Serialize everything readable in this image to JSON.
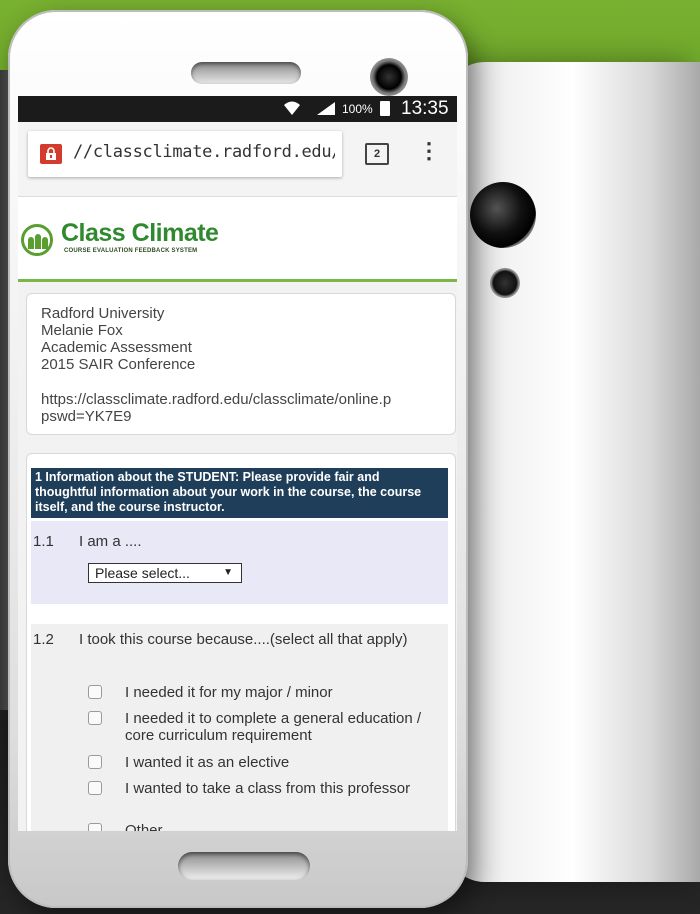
{
  "status": {
    "battery": "100%",
    "time": "13:35"
  },
  "browser": {
    "url": "//classclimate.radford.edu/c",
    "tab_count": "2",
    "menu_icon": "⋮"
  },
  "logo": {
    "title": "Class Climate",
    "subtitle": "COURSE EVALUATION FEEDBACK SYSTEM"
  },
  "info": {
    "lines": [
      "Radford University",
      "Melanie Fox",
      "Academic Assessment",
      "2015 SAIR Conference"
    ],
    "link_line1": "https://classclimate.radford.edu/classclimate/online.p",
    "link_line2": "pswd=YK7E9"
  },
  "section": {
    "header": "1   Information about the STUDENT: Please provide fair and thoughtful information about your work in the course, the course itself, and the course instructor."
  },
  "q1": {
    "number": "1.1",
    "text": "I am a ....",
    "select_value": "Please select...",
    "select_arrow": "▼"
  },
  "q2": {
    "number": "1.2",
    "text": "I took this course because....(select all that apply)",
    "options": [
      "I needed it for my major / minor",
      "I needed it to complete a general education / core curriculum requirement",
      "I wanted it as an elective",
      "I wanted to take a class from this professor",
      "Other"
    ]
  }
}
